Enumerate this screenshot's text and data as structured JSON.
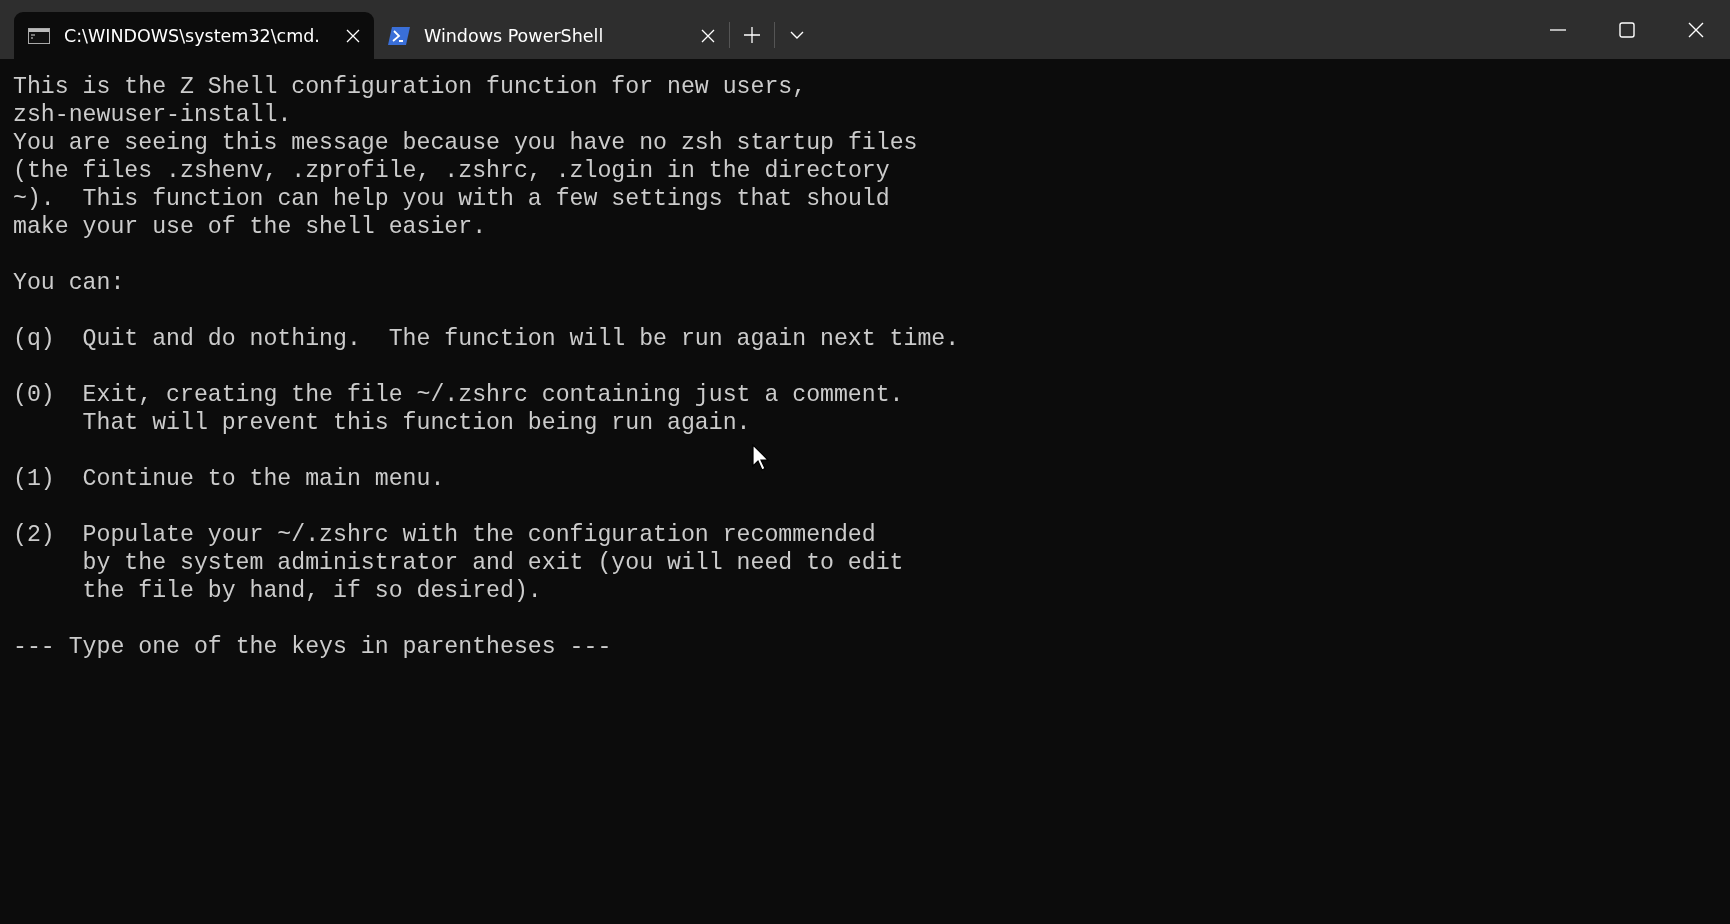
{
  "tabs": [
    {
      "kind": "cmd",
      "title": "C:\\WINDOWS\\system32\\cmd.",
      "selected": true
    },
    {
      "kind": "powershell",
      "title": "Windows PowerShell",
      "selected": false
    }
  ],
  "terminal": {
    "blocks": [
      {
        "kind": "text",
        "lines": [
          "This is the Z Shell configuration function for new users,",
          "zsh-newuser-install.",
          "You are seeing this message because you have no zsh startup files",
          "(the files .zshenv, .zprofile, .zshrc, .zlogin in the directory",
          "~).  This function can help you with a few settings that should",
          "make your use of the shell easier."
        ]
      },
      {
        "kind": "text",
        "lines": [
          "You can:"
        ]
      },
      {
        "kind": "option",
        "key": "(q)",
        "lines": [
          "Quit and do nothing.  The function will be run again next time."
        ]
      },
      {
        "kind": "option",
        "key": "(0)",
        "lines": [
          "Exit, creating the file ~/.zshrc containing just a comment.",
          "That will prevent this function being run again."
        ]
      },
      {
        "kind": "option",
        "key": "(1)",
        "lines": [
          "Continue to the main menu."
        ]
      },
      {
        "kind": "option",
        "key": "(2)",
        "lines": [
          "Populate your ~/.zshrc with the configuration recommended",
          "by the system administrator and exit (you will need to edit",
          "the file by hand, if so desired)."
        ]
      },
      {
        "kind": "text",
        "lines": [
          "--- Type one of the keys in parentheses ---"
        ]
      }
    ]
  }
}
